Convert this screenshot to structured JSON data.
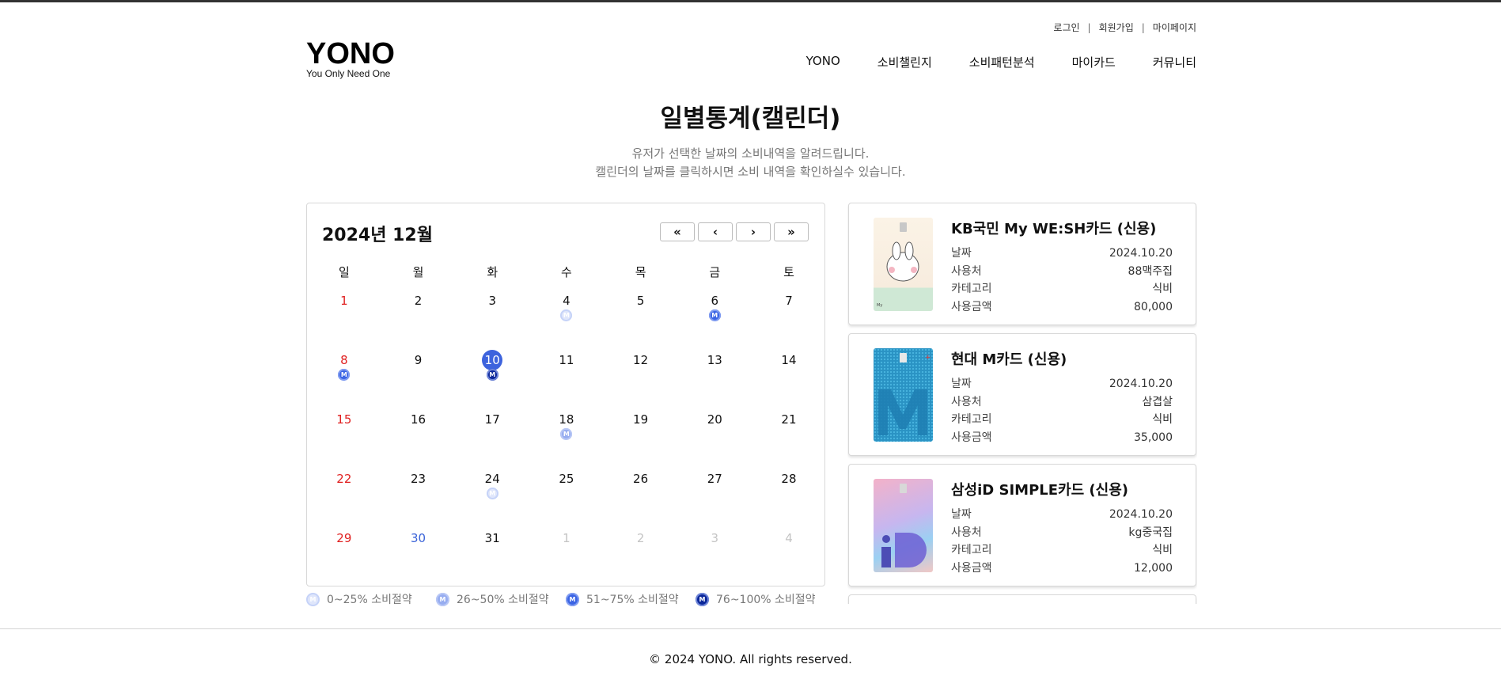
{
  "header": {
    "util_links": [
      "로그인",
      "회원가입",
      "마이페이지"
    ],
    "logo_main": "YONO",
    "logo_sub": "You Only Need One",
    "nav": [
      "YONO",
      "소비챌린지",
      "소비패턴분석",
      "마이카드",
      "커뮤니티"
    ]
  },
  "page": {
    "title": "일별통계(캘린더)",
    "desc_line1": "유저가 선택한 날짜의 소비내역을 알려드립니다.",
    "desc_line2": "캘린더의 날짜를 클릭하시면 소비 내역을 확인하실수 있습니다."
  },
  "calendar": {
    "title": "2024년 12월",
    "nav_buttons": [
      "«",
      "‹",
      "›",
      "»"
    ],
    "weekdays": [
      "일",
      "월",
      "화",
      "수",
      "목",
      "금",
      "토"
    ],
    "badge_text": "M",
    "weeks": [
      [
        {
          "d": "1",
          "t": "sun"
        },
        {
          "d": "2"
        },
        {
          "d": "3"
        },
        {
          "d": "4",
          "lv": 1
        },
        {
          "d": "5"
        },
        {
          "d": "6",
          "lv": 3
        },
        {
          "d": "7"
        }
      ],
      [
        {
          "d": "8",
          "t": "sun",
          "lv": 3
        },
        {
          "d": "9"
        },
        {
          "d": "10",
          "t": "today",
          "lv": 4
        },
        {
          "d": "11"
        },
        {
          "d": "12"
        },
        {
          "d": "13"
        },
        {
          "d": "14"
        }
      ],
      [
        {
          "d": "15",
          "t": "sun"
        },
        {
          "d": "16"
        },
        {
          "d": "17"
        },
        {
          "d": "18",
          "lv": 2
        },
        {
          "d": "19"
        },
        {
          "d": "20"
        },
        {
          "d": "21"
        }
      ],
      [
        {
          "d": "22",
          "t": "sun"
        },
        {
          "d": "23"
        },
        {
          "d": "24",
          "lv": 1
        },
        {
          "d": "25"
        },
        {
          "d": "26"
        },
        {
          "d": "27"
        },
        {
          "d": "28"
        }
      ],
      [
        {
          "d": "29",
          "t": "sun"
        },
        {
          "d": "30",
          "t": "blue"
        },
        {
          "d": "31"
        },
        {
          "d": "1",
          "t": "other"
        },
        {
          "d": "2",
          "t": "other"
        },
        {
          "d": "3",
          "t": "other"
        },
        {
          "d": "4",
          "t": "other"
        }
      ]
    ]
  },
  "legend": [
    {
      "label": "0~25% 소비절약",
      "lv": 1
    },
    {
      "label": "26~50% 소비절약",
      "lv": 2
    },
    {
      "label": "51~75% 소비절약",
      "lv": 3
    },
    {
      "label": "76~100% 소비절약",
      "lv": 4
    }
  ],
  "cards": [
    {
      "name": "KB국민 My WE:SH카드 (신용)",
      "date_label": "날짜",
      "date": "2024.10.20",
      "place_label": "사용처",
      "place": "88맥주집",
      "cat_label": "카테고리",
      "cat": "식비",
      "amt_label": "사용금액",
      "amt": "80,000"
    },
    {
      "name": "현대 M카드 (신용)",
      "date_label": "날짜",
      "date": "2024.10.20",
      "place_label": "사용처",
      "place": "삼겹살",
      "cat_label": "카테고리",
      "cat": "식비",
      "amt_label": "사용금액",
      "amt": "35,000"
    },
    {
      "name": "삼성iD SIMPLE카드 (신용)",
      "date_label": "날짜",
      "date": "2024.10.20",
      "place_label": "사용처",
      "place": "kg중국집",
      "cat_label": "카테고리",
      "cat": "식비",
      "amt_label": "사용금액",
      "amt": "12,000"
    }
  ],
  "footer": {
    "copyright": "© 2024 YONO. All rights reserved."
  }
}
